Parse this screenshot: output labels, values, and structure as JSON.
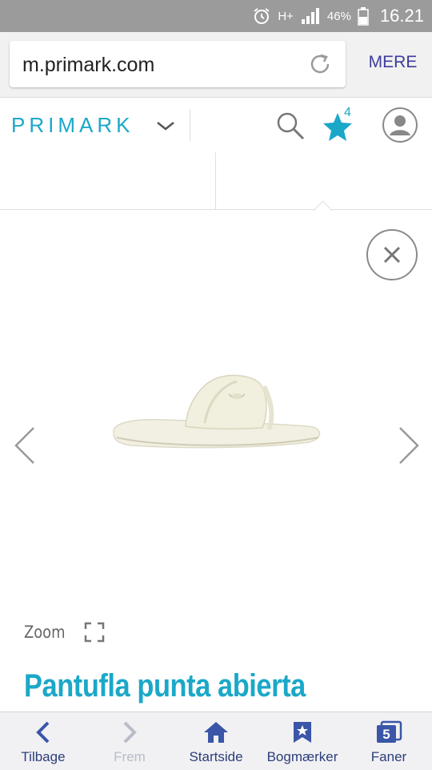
{
  "status_bar": {
    "network": "H+",
    "battery": "46%",
    "time": "16.21"
  },
  "browser": {
    "url": "m.primark.com",
    "more_label": "MERE"
  },
  "site_header": {
    "logo": "PRIMARK",
    "wishlist_count": "4",
    "brand_color": "#1ba8c8"
  },
  "product": {
    "zoom_label": "Zoom",
    "title": "Pantufla punta abierta"
  },
  "bottom_nav": {
    "items": [
      {
        "label": "Tilbage",
        "icon": "back-icon"
      },
      {
        "label": "Frem",
        "icon": "forward-icon"
      },
      {
        "label": "Startside",
        "icon": "home-icon"
      },
      {
        "label": "Bogmærker",
        "icon": "bookmark-icon"
      },
      {
        "label": "Faner",
        "icon": "tabs-icon",
        "badge": "5"
      }
    ]
  }
}
